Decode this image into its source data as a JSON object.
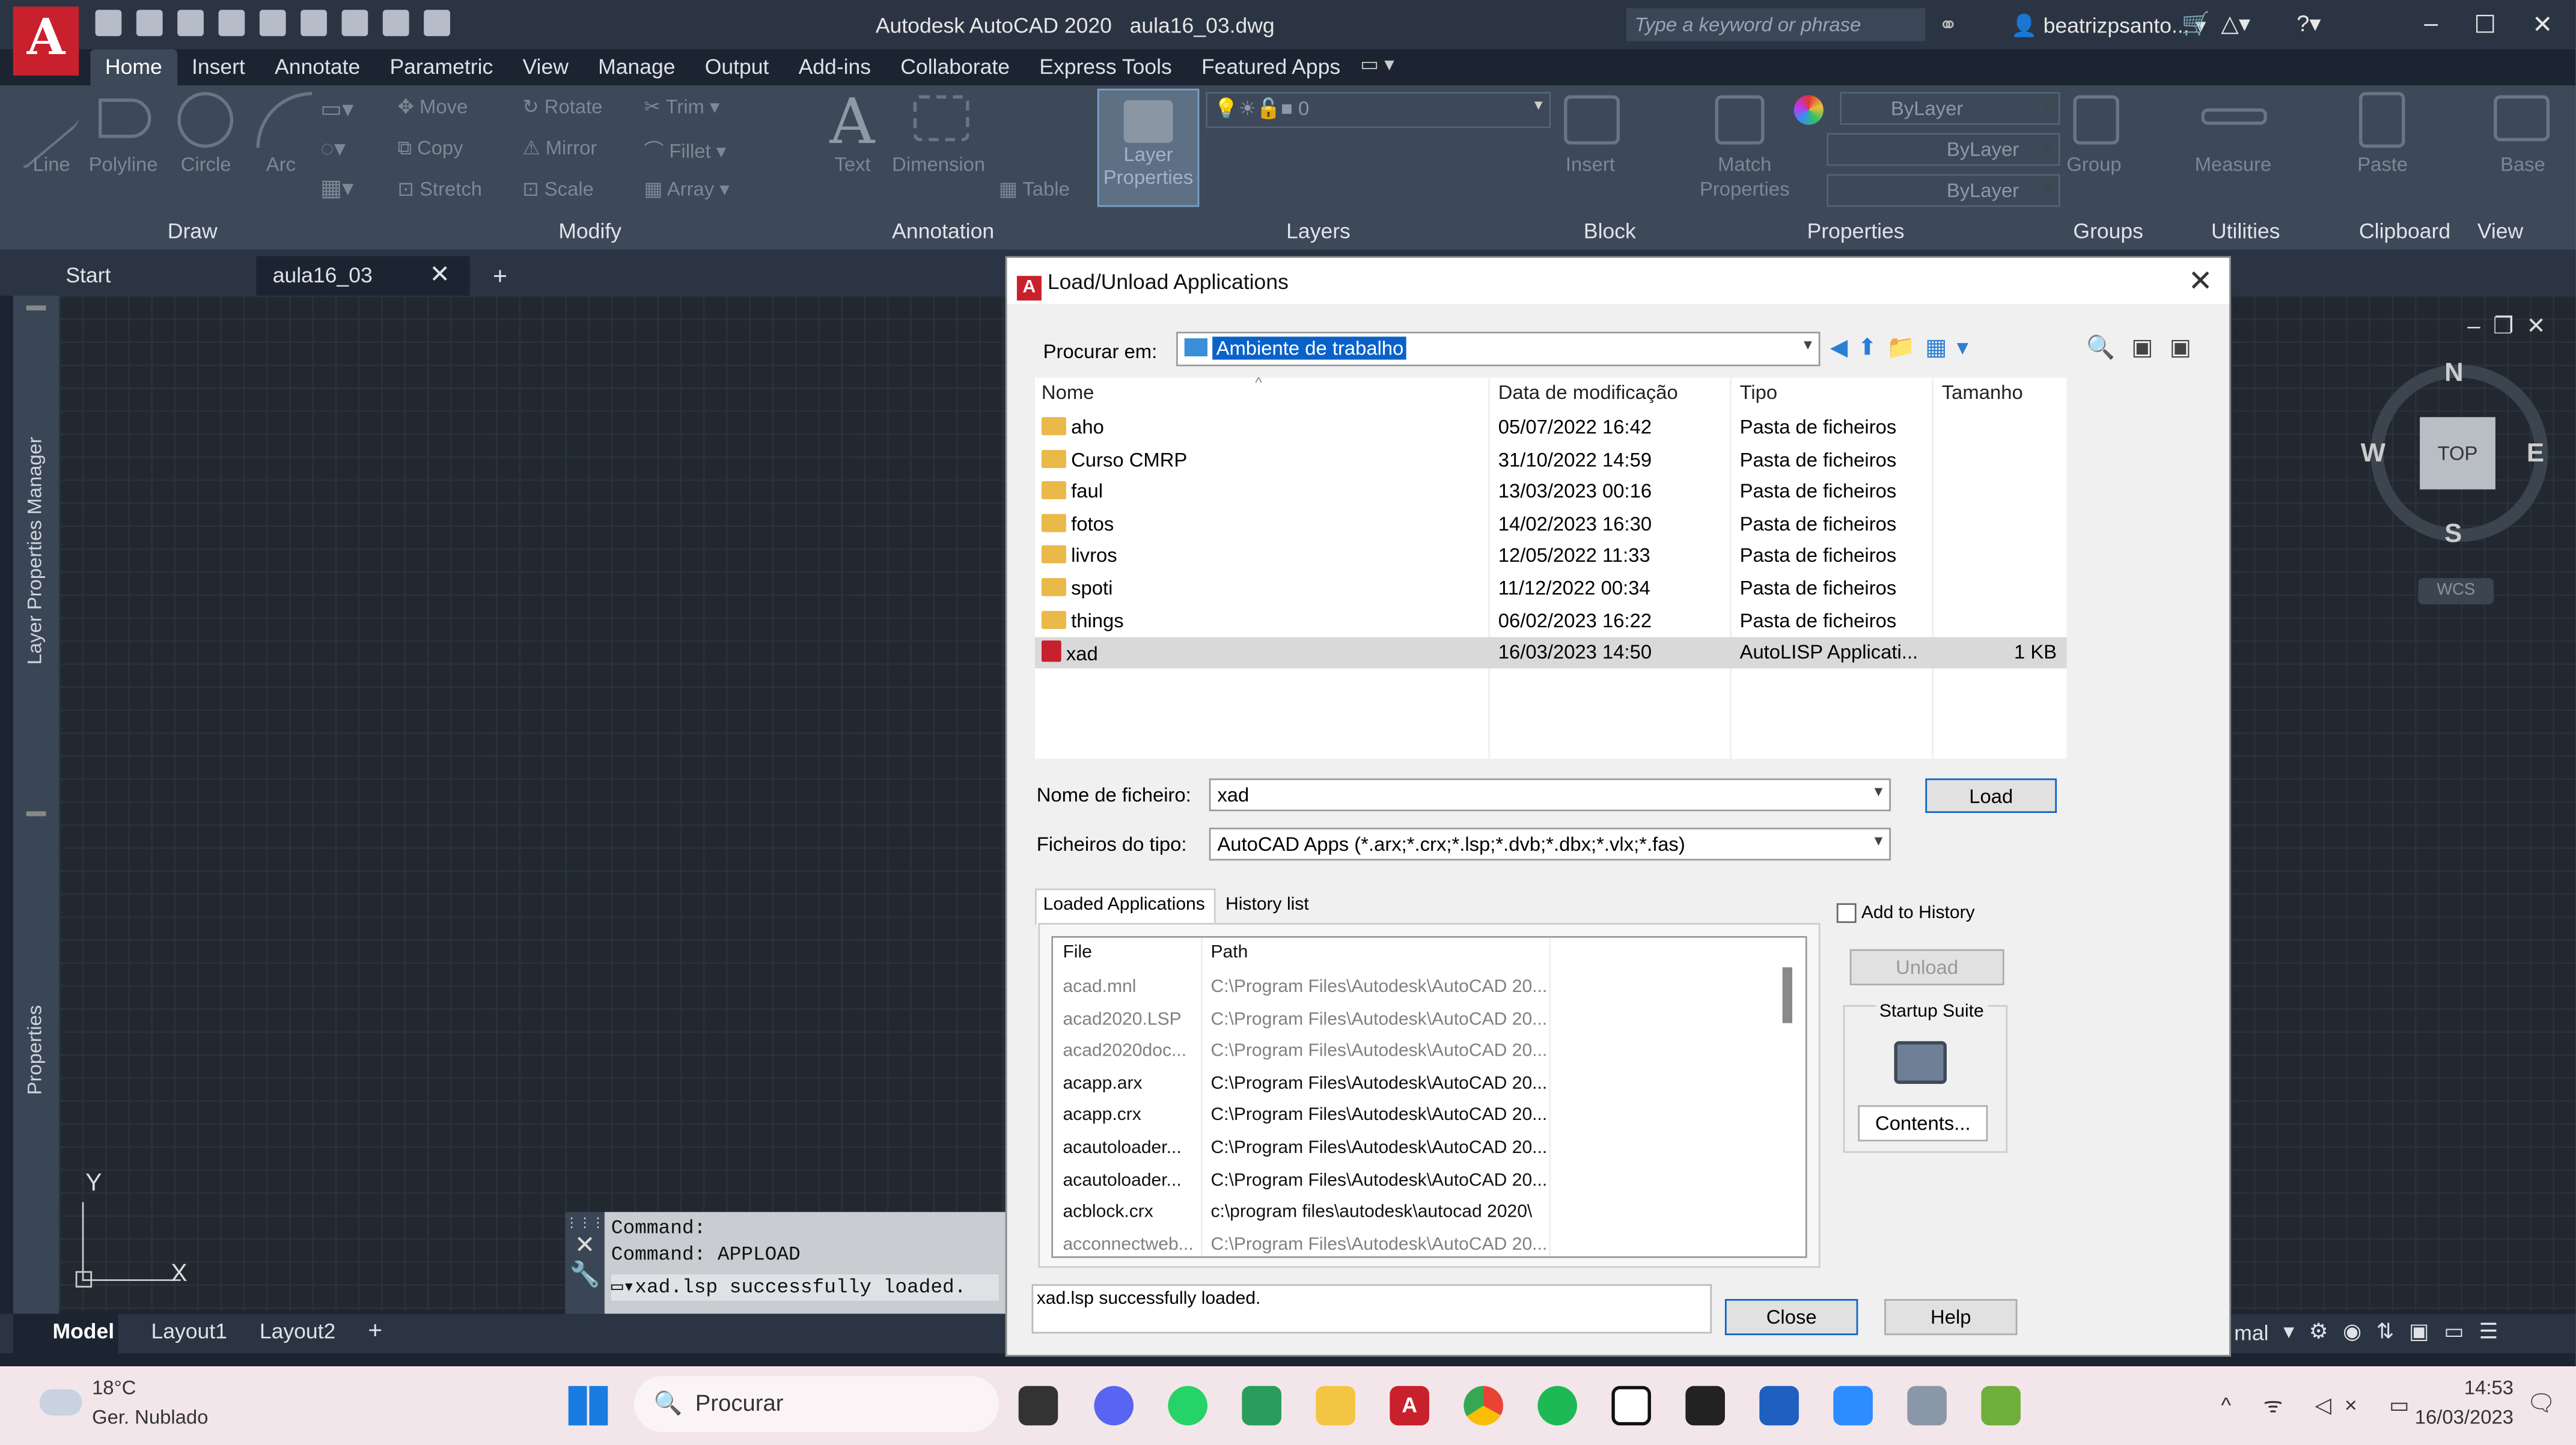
{
  "app": {
    "title": "Autodesk AutoCAD 2020",
    "file": "aula16_03.dwg",
    "search_placeholder": "Type a keyword or phrase",
    "user": "beatrizpsanto..."
  },
  "menu_tabs": [
    "Home",
    "Insert",
    "Annotate",
    "Parametric",
    "View",
    "Manage",
    "Output",
    "Add-ins",
    "Collaborate",
    "Express Tools",
    "Featured Apps"
  ],
  "ribbon": {
    "draw": [
      "Line",
      "Polyline",
      "Circle",
      "Arc"
    ],
    "modify": [
      "Move",
      "Rotate",
      "Trim",
      "Copy",
      "Mirror",
      "Fillet",
      "Stretch",
      "Scale",
      "Array"
    ],
    "annotation": [
      "Text",
      "Dimension",
      "Table"
    ],
    "layer_props": "Layer Properties",
    "layer_value": "0",
    "block": "Insert",
    "match": "Match Properties",
    "bylayer": [
      "ByLayer",
      "ByLayer",
      "ByLayer"
    ],
    "group": "Group",
    "measure": "Measure",
    "paste": "Paste",
    "base": "Base",
    "panels": [
      "Draw",
      "Modify",
      "Annotation",
      "Layers",
      "Block",
      "Properties",
      "Groups",
      "Utilities",
      "Clipboard",
      "View"
    ]
  },
  "doc_tabs": [
    "Start",
    "aula16_03"
  ],
  "palettes": [
    "Layer Properties Manager",
    "Properties"
  ],
  "command": {
    "lines": [
      "Command:",
      "Command: APPLOAD",
      "xad.lsp successfully loaded."
    ]
  },
  "layout_tabs": [
    "Model",
    "Layout1",
    "Layout2"
  ],
  "status_right": "mal",
  "viewcube": {
    "n": "N",
    "s": "S",
    "e": "E",
    "w": "W",
    "top": "TOP",
    "wcs": "WCS"
  },
  "ucs": {
    "y": "Y",
    "x": "X"
  },
  "dialog": {
    "title": "Load/Unload Applications",
    "look_in_label": "Procurar em:",
    "look_in": "Ambiente de trabalho",
    "columns": [
      "Nome",
      "Data de modificação",
      "Tipo",
      "Tamanho"
    ],
    "files": [
      {
        "name": "aho",
        "date": "05/07/2022 16:42",
        "type": "Pasta de ficheiros",
        "size": ""
      },
      {
        "name": "Curso CMRP",
        "date": "31/10/2022 14:59",
        "type": "Pasta de ficheiros",
        "size": ""
      },
      {
        "name": "faul",
        "date": "13/03/2023 00:16",
        "type": "Pasta de ficheiros",
        "size": ""
      },
      {
        "name": "fotos",
        "date": "14/02/2023 16:30",
        "type": "Pasta de ficheiros",
        "size": ""
      },
      {
        "name": "livros",
        "date": "12/05/2022 11:33",
        "type": "Pasta de ficheiros",
        "size": ""
      },
      {
        "name": "spoti",
        "date": "11/12/2022 00:34",
        "type": "Pasta de ficheiros",
        "size": ""
      },
      {
        "name": "things",
        "date": "06/02/2023 16:22",
        "type": "Pasta de ficheiros",
        "size": ""
      },
      {
        "name": "xad",
        "date": "16/03/2023 14:50",
        "type": "AutoLISP Applicati...",
        "size": "1 KB"
      }
    ],
    "filename_label": "Nome de ficheiro:",
    "filename": "xad",
    "filetype_label": "Ficheiros do tipo:",
    "filetype": "AutoCAD Apps (*.arx;*.crx;*.lsp;*.dvb;*.dbx;*.vlx;*.fas)",
    "load": "Load",
    "tab_loaded": "Loaded Applications",
    "tab_history": "History list",
    "add_history": "Add to History",
    "unload": "Unload",
    "startup": "Startup Suite",
    "contents": "Contents...",
    "loaded_cols": [
      "File",
      "Path"
    ],
    "loaded": [
      {
        "file": "acad.mnl",
        "path": "C:\\Program Files\\Autodesk\\AutoCAD 20...",
        "dark": false
      },
      {
        "file": "acad2020.LSP",
        "path": "C:\\Program Files\\Autodesk\\AutoCAD 20...",
        "dark": false
      },
      {
        "file": "acad2020doc...",
        "path": "C:\\Program Files\\Autodesk\\AutoCAD 20...",
        "dark": false
      },
      {
        "file": "acapp.arx",
        "path": "C:\\Program Files\\Autodesk\\AutoCAD 20...",
        "dark": true
      },
      {
        "file": "acapp.crx",
        "path": "C:\\Program Files\\Autodesk\\AutoCAD 20...",
        "dark": true
      },
      {
        "file": "acautoloader...",
        "path": "C:\\Program Files\\Autodesk\\AutoCAD 20...",
        "dark": true
      },
      {
        "file": "acautoloader...",
        "path": "C:\\Program Files\\Autodesk\\AutoCAD 20...",
        "dark": true
      },
      {
        "file": "acblock.crx",
        "path": "c:\\program files\\autodesk\\autocad 2020\\",
        "dark": true
      },
      {
        "file": "acconnectweb...",
        "path": "C:\\Program Files\\Autodesk\\AutoCAD 20...",
        "dark": false
      }
    ],
    "status": "xad.lsp successfully loaded.",
    "close": "Close",
    "help": "Help"
  },
  "taskbar": {
    "temp": "18°C",
    "weather": "Ger. Nublado",
    "search": "Procurar",
    "time": "14:53",
    "date": "16/03/2023"
  }
}
